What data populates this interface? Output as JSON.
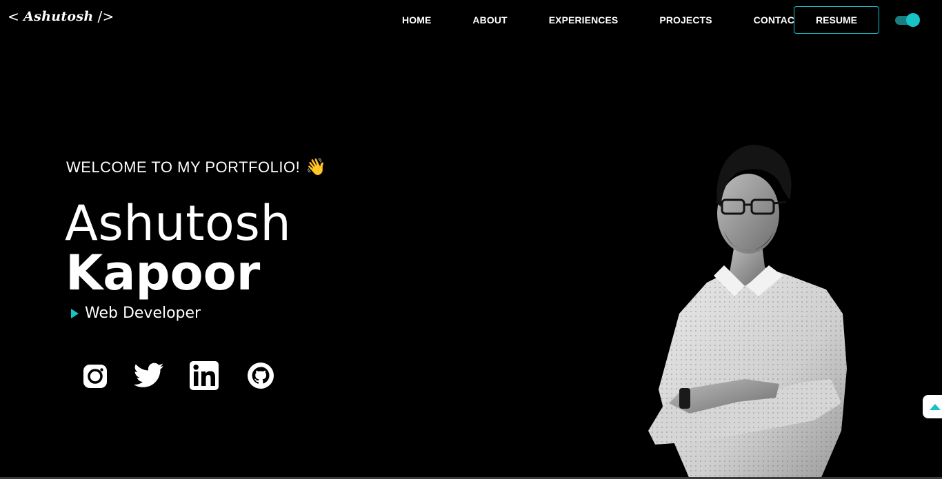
{
  "logo": {
    "open": "<",
    "name": "Ashutosh",
    "close": "/>"
  },
  "nav": {
    "items": [
      {
        "label": "HOME"
      },
      {
        "label": "ABOUT"
      },
      {
        "label": "EXPERIENCES"
      },
      {
        "label": "PROJECTS"
      },
      {
        "label": "CONTACT"
      }
    ],
    "resume_label": "RESUME"
  },
  "theme_toggle": {
    "state": "on",
    "accent": "#17c3c7"
  },
  "hero": {
    "welcome": "WELCOME TO MY PORTFOLIO!",
    "wave_emoji": "👋",
    "first_name": "Ashutosh",
    "last_name": "Kapoor",
    "role": "Web Developer"
  },
  "socials": [
    {
      "icon": "instagram-icon"
    },
    {
      "icon": "twitter-icon"
    },
    {
      "icon": "linkedin-icon"
    },
    {
      "icon": "github-icon"
    }
  ],
  "colors": {
    "background": "#000000",
    "accent": "#17c3c7",
    "text": "#ffffff"
  }
}
